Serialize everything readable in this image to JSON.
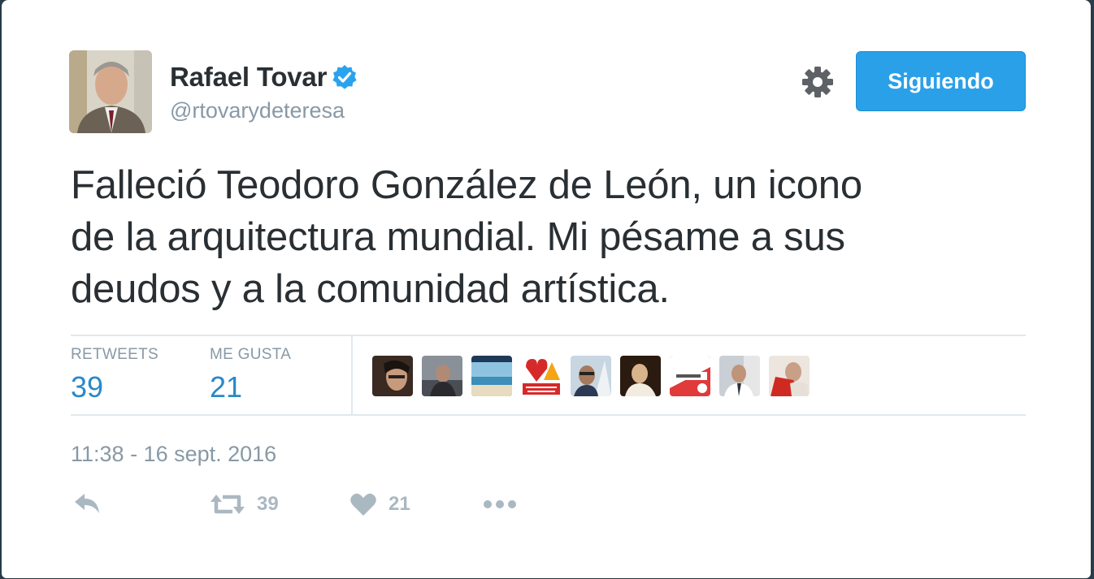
{
  "header": {
    "name": "Rafael Tovar",
    "handle": "@rtovarydeteresa",
    "follow_label": "Siguiendo"
  },
  "tweet": {
    "lines": [
      "Falleció Teodoro González de León, un icono",
      "de la arquitectura mundial. Mi pésame a sus",
      "deudos y a la comunidad artística."
    ]
  },
  "stats": {
    "retweets_label": "RETWEETS",
    "retweets_value": "39",
    "likes_label": "ME GUSTA",
    "likes_value": "21"
  },
  "likers": [
    "avatar-1",
    "avatar-2",
    "avatar-3",
    "avatar-4",
    "avatar-5",
    "avatar-6",
    "avatar-7",
    "avatar-8",
    "avatar-9"
  ],
  "timestamp": "11:38 - 16 sept. 2016",
  "actions": {
    "retweet_count": "39",
    "like_count": "21"
  },
  "colors": {
    "accent": "#2aa0e8",
    "text": "#292f33",
    "muted": "#8899a6",
    "stat_blue": "#2a88c8",
    "icon_gray": "#aab8c2"
  }
}
